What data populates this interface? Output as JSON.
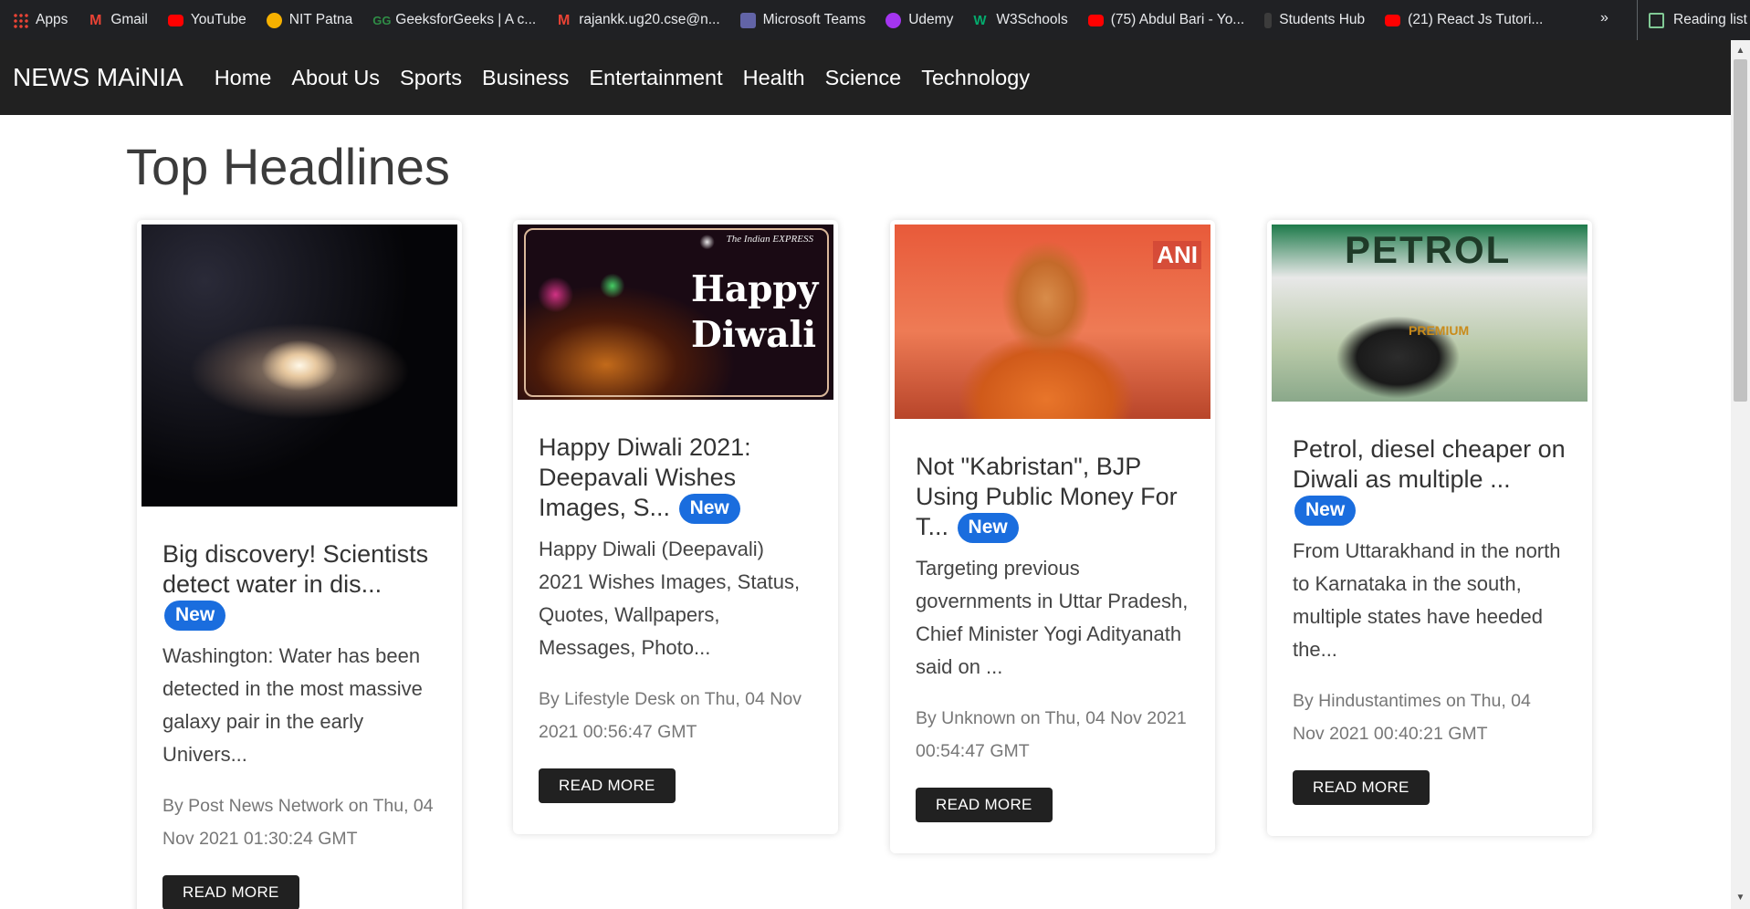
{
  "bookmarks": [
    {
      "label": "Apps",
      "icon": "apps-grid-icon",
      "color": "#ea4335"
    },
    {
      "label": "Gmail",
      "icon": "gmail-icon",
      "color": "#ea4335"
    },
    {
      "label": "YouTube",
      "icon": "youtube-icon",
      "color": "#ff0000"
    },
    {
      "label": "NIT Patna",
      "icon": "nit-patna-icon",
      "color": "#f6b100"
    },
    {
      "label": "GeeksforGeeks | A c...",
      "icon": "geeksforgeeks-icon",
      "color": "#2f8d46"
    },
    {
      "label": "rajankk.ug20.cse@n...",
      "icon": "gmail-icon",
      "color": "#ea4335"
    },
    {
      "label": "Microsoft Teams",
      "icon": "teams-icon",
      "color": "#6264a7"
    },
    {
      "label": "Udemy",
      "icon": "udemy-icon",
      "color": "#a435f0"
    },
    {
      "label": "W3Schools",
      "icon": "w3schools-icon",
      "color": "#04aa6d"
    },
    {
      "label": "(75) Abdul Bari - Yo...",
      "icon": "youtube-icon",
      "color": "#ff0000"
    },
    {
      "label": "Students Hub",
      "icon": "students-hub-icon",
      "color": "#3c3c3c"
    },
    {
      "label": "(21) React Js Tutori...",
      "icon": "youtube-icon",
      "color": "#ff0000"
    }
  ],
  "bookmarks_more": "»",
  "reading_list": "Reading list",
  "navbar": {
    "brand": "NEWS MAiNIA",
    "links": [
      "Home",
      "About Us",
      "Sports",
      "Business",
      "Entertainment",
      "Health",
      "Science",
      "Technology"
    ]
  },
  "page_title": "Top Headlines",
  "cards": [
    {
      "image": "galaxy-image",
      "title": "Big discovery! Scientists detect water in dis...",
      "badge": "New",
      "text": "Washington: Water has been detected in the most massive galaxy pair in the early Univers...",
      "meta": "By Post News Network on Thu, 04 Nov 2021 01:30:24 GMT",
      "button": "READ MORE"
    },
    {
      "image": "happy-diwali-image",
      "image_text": {
        "source": "The Indian EXPRESS",
        "line1": "Happy",
        "line2": "Diwali"
      },
      "title": "Happy Diwali 2021: Deepavali Wishes Images, S...",
      "badge": "New",
      "text": "Happy Diwali (Deepavali) 2021 Wishes Images, Status, Quotes, Wallpapers, Messages, Photo...",
      "meta": "By Lifestyle Desk on Thu, 04 Nov 2021 00:56:47 GMT",
      "button": "READ MORE"
    },
    {
      "image": "yogi-adityanath-image",
      "image_text": {
        "source": "ANI"
      },
      "title": "Not \"Kabristan\", BJP Using Public Money For T...",
      "badge": "New",
      "text": "Targeting previous governments in Uttar Pradesh, Chief Minister Yogi Adityanath said on ...",
      "meta": "By Unknown on Thu, 04 Nov 2021 00:54:47 GMT",
      "button": "READ MORE"
    },
    {
      "image": "petrol-pump-image",
      "image_text": {
        "line1": "PETROL",
        "line2": "PREMIUM"
      },
      "title": "Petrol, diesel cheaper on Diwali as multiple ...",
      "badge": "New",
      "text": "From Uttarakhand in the north to Karnataka in the south, multiple states have heeded the...",
      "meta": "By Hindustantimes on Thu, 04 Nov 2021 00:40:21 GMT",
      "button": "READ MORE"
    }
  ],
  "colors": {
    "navbar": "#212121",
    "badge": "#1a6dde",
    "button": "#212121",
    "bookmarks_bar": "#202124"
  }
}
